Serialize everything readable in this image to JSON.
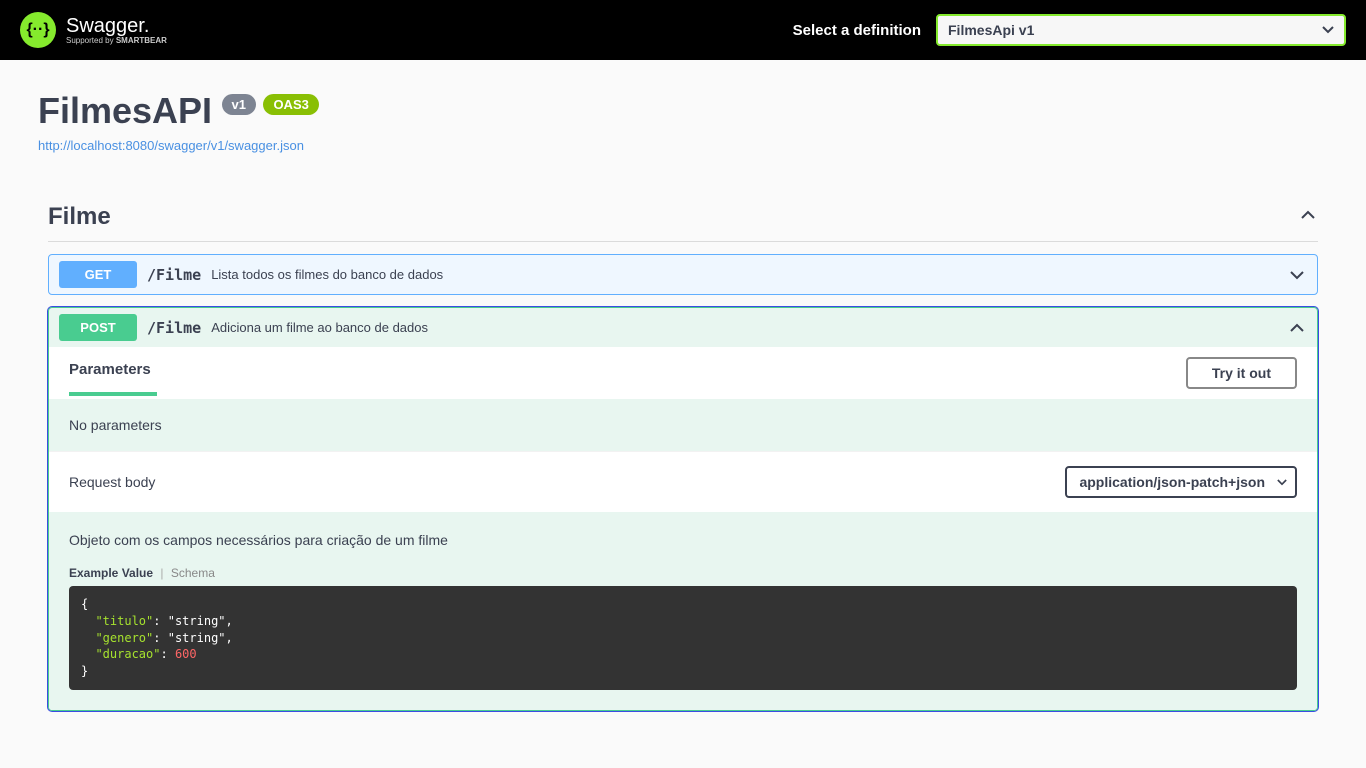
{
  "topbar": {
    "logo_braces": "{··}",
    "logo_main": "Swagger",
    "logo_sub_prefix": "Supported by ",
    "logo_sub_brand": "SMARTBEAR",
    "select_label": "Select a definition",
    "definition_value": "FilmesApi v1"
  },
  "info": {
    "title": "FilmesAPI",
    "version_badge": "v1",
    "oas_badge": "OAS3",
    "spec_url": "http://localhost:8080/swagger/v1/swagger.json"
  },
  "tag": {
    "name": "Filme"
  },
  "operations": {
    "get": {
      "method": "GET",
      "path": "/Filme",
      "desc": "Lista todos os filmes do banco de dados"
    },
    "post": {
      "method": "POST",
      "path": "/Filme",
      "desc": "Adiciona um filme ao banco de dados"
    }
  },
  "post_detail": {
    "params_title": "Parameters",
    "try_label": "Try it out",
    "no_params": "No parameters",
    "reqbody_title": "Request body",
    "content_type": "application/json-patch+json",
    "reqbody_desc": "Objeto com os campos necessários para criação de um filme",
    "tab_example": "Example Value",
    "tab_schema": "Schema",
    "example_json": {
      "titulo": "string",
      "genero": "string",
      "duracao": 600
    }
  }
}
